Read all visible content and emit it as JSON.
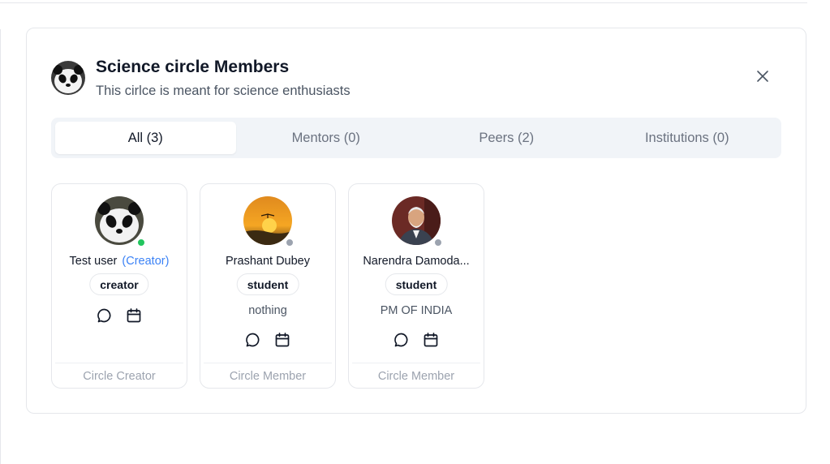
{
  "dialog": {
    "title": "Science circle Members",
    "subtitle": "This cirlce is meant for science enthusiasts",
    "close_icon": "close-icon"
  },
  "tabs": [
    {
      "label": "All (3)",
      "active": true
    },
    {
      "label": "Mentors (0)",
      "active": false
    },
    {
      "label": "Peers (2)",
      "active": false
    },
    {
      "label": "Institutions (0)",
      "active": false
    }
  ],
  "members": [
    {
      "name": "Test user",
      "role_tag": "(Creator)",
      "badge": "creator",
      "bio": "",
      "status": "online",
      "footer": "Circle Creator"
    },
    {
      "name": "Prashant Dubey",
      "role_tag": "",
      "badge": "student",
      "bio": "nothing",
      "status": "offline",
      "footer": "Circle Member"
    },
    {
      "name": "Narendra Damoda...",
      "role_tag": "",
      "badge": "student",
      "bio": "PM OF INDIA",
      "status": "offline",
      "footer": "Circle Member"
    }
  ],
  "colors": {
    "accent": "#3b82f6",
    "online": "#22c55e",
    "offline": "#9ca3af",
    "tabs_bg": "#f1f4f8"
  },
  "icons": [
    "chat-bubble-icon",
    "calendar-icon",
    "close-icon"
  ]
}
